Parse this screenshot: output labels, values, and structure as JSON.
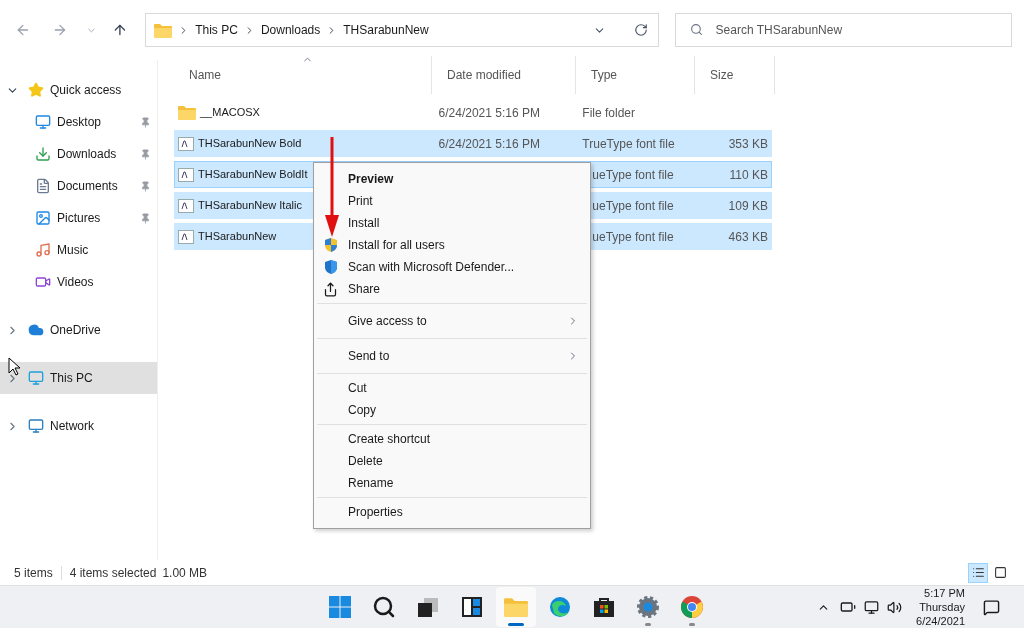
{
  "address": {
    "path": [
      "This PC",
      "Downloads",
      "THSarabunNew"
    ]
  },
  "search": {
    "placeholder": "Search THSarabunNew"
  },
  "nav": [
    {
      "label": "Quick access",
      "kind": "group",
      "expanded": true,
      "selected": false
    },
    {
      "label": "Desktop",
      "kind": "pinned",
      "selected": false
    },
    {
      "label": "Downloads",
      "kind": "pinned",
      "selected": false
    },
    {
      "label": "Documents",
      "kind": "pinned",
      "selected": false
    },
    {
      "label": "Pictures",
      "kind": "pinned",
      "selected": false
    },
    {
      "label": "Music",
      "kind": "item",
      "selected": false
    },
    {
      "label": "Videos",
      "kind": "item",
      "selected": false
    },
    {
      "label": "OneDrive",
      "kind": "group",
      "expanded": false,
      "selected": false
    },
    {
      "label": "This PC",
      "kind": "group",
      "expanded": false,
      "selected": true
    },
    {
      "label": "Network",
      "kind": "group",
      "expanded": false,
      "selected": false
    }
  ],
  "table": {
    "columns": [
      "Name",
      "Date modified",
      "Type",
      "Size"
    ],
    "rows": [
      {
        "kind": "folder",
        "name": "__MACOSX",
        "date": "6/24/2021 5:16 PM",
        "type": "File folder",
        "selected": false,
        "focused": false
      },
      {
        "kind": "font",
        "name": "THSarabunNew Bold",
        "date": "6/24/2021 5:16 PM",
        "type": "TrueType font file",
        "size": "353 KB",
        "selected": true,
        "focused": false
      },
      {
        "kind": "font",
        "name": "THSarabunNew BoldIt",
        "type": "ueType font file",
        "size": "110 KB",
        "selected": true,
        "focused": true
      },
      {
        "kind": "font",
        "name": "THSarabunNew Italic",
        "type": "ueType font file",
        "size": "109 KB",
        "selected": true,
        "focused": false
      },
      {
        "kind": "font",
        "name": "THSarabunNew",
        "type": "ueType font file",
        "size": "463 KB",
        "selected": true,
        "focused": false
      }
    ]
  },
  "context_menu": {
    "groups": [
      [
        {
          "label": "Preview",
          "bold": true
        },
        {
          "label": "Print"
        },
        {
          "label": "Install"
        },
        {
          "label": "Install for all users",
          "kind": "uac"
        },
        {
          "label": "Scan with Microsoft Defender...",
          "kind": "defender"
        },
        {
          "label": "Share",
          "kind": "share"
        }
      ],
      [
        {
          "label": "Give access to",
          "submenu": true
        }
      ],
      [
        {
          "label": "Send to",
          "submenu": true
        }
      ],
      [
        {
          "label": "Cut"
        },
        {
          "label": "Copy"
        }
      ],
      [
        {
          "label": "Create shortcut"
        },
        {
          "label": "Delete"
        },
        {
          "label": "Rename"
        }
      ],
      [
        {
          "label": "Properties"
        }
      ]
    ]
  },
  "status_bar": {
    "items": "5 items",
    "selection": "4 items selected",
    "size": "1.00 MB"
  },
  "taskbar": {
    "apps": [
      {
        "running": false,
        "selected": false
      },
      {
        "running": false,
        "selected": false
      },
      {
        "running": false,
        "selected": false
      },
      {
        "running": false,
        "selected": false
      },
      {
        "running": true,
        "selected": true
      },
      {
        "running": false,
        "selected": false
      },
      {
        "running": false,
        "selected": false
      },
      {
        "running": true,
        "selected": false
      },
      {
        "running": true,
        "selected": false
      }
    ],
    "time": "5:17 PM",
    "day": "Thursday",
    "date": "6/24/2021"
  }
}
